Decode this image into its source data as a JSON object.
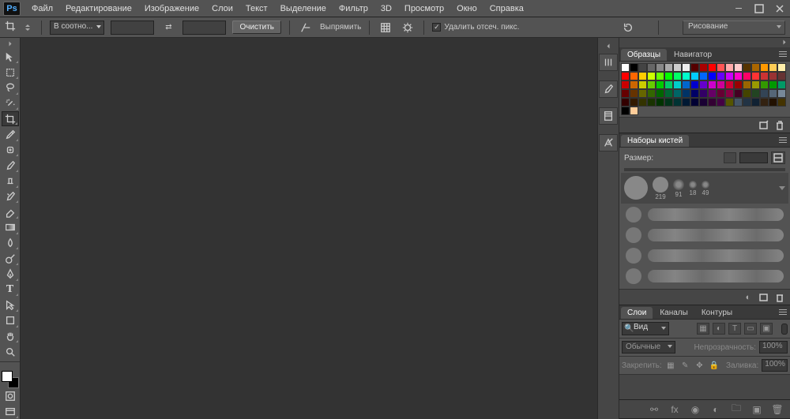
{
  "app": {
    "logo": "Ps"
  },
  "menubar": [
    "Файл",
    "Редактирование",
    "Изображение",
    "Слои",
    "Текст",
    "Выделение",
    "Фильтр",
    "3D",
    "Просмотр",
    "Окно",
    "Справка"
  ],
  "options": {
    "ratio_label": "В соотно...",
    "clear_label": "Очистить",
    "straighten_label": "Выпрямить",
    "delete_cropped_label": "Удалить отсеч. пикс."
  },
  "workspace": {
    "selected": "Рисование"
  },
  "panels": {
    "swatches": {
      "tabs": [
        "Образцы",
        "Навигатор"
      ],
      "active": 0,
      "colors": [
        "#ffffff",
        "#000000",
        "#444444",
        "#666666",
        "#888888",
        "#aaaaaa",
        "#cccccc",
        "#eeeeee",
        "#550000",
        "#aa0000",
        "#ff0000",
        "#ff5555",
        "#ffaaaa",
        "#ffcccc",
        "#553300",
        "#aa6600",
        "#ff9900",
        "#ffcc55",
        "#ffeeaa",
        "#ff0000",
        "#ff6600",
        "#ffcc00",
        "#ccff00",
        "#66ff00",
        "#00ff00",
        "#00ff66",
        "#00ffcc",
        "#00ccff",
        "#0066ff",
        "#0000ff",
        "#6600ff",
        "#cc00ff",
        "#ff00cc",
        "#ff0066",
        "#ff3333",
        "#cc3333",
        "#993333",
        "#663333",
        "#cc0000",
        "#cc6600",
        "#cccc00",
        "#66cc00",
        "#00cc00",
        "#00cc66",
        "#00cccc",
        "#0066cc",
        "#0000cc",
        "#6600cc",
        "#cc00cc",
        "#cc0099",
        "#cc0033",
        "#990000",
        "#996600",
        "#999900",
        "#339900",
        "#009900",
        "#009966",
        "#660000",
        "#663300",
        "#666600",
        "#336600",
        "#006600",
        "#006633",
        "#006666",
        "#003366",
        "#000066",
        "#330066",
        "#660066",
        "#660033",
        "#880044",
        "#440022",
        "#444400",
        "#224422",
        "#334455",
        "#556677",
        "#778899",
        "#330000",
        "#331900",
        "#333300",
        "#193300",
        "#003300",
        "#003319",
        "#003333",
        "#001933",
        "#000033",
        "#190033",
        "#330033",
        "#440044",
        "#555500",
        "#445566",
        "#223344",
        "#112233",
        "#332211",
        "#221100",
        "#443300",
        "#000000",
        "#ffcc99"
      ]
    },
    "brushes": {
      "tabs": [
        "Наборы кистей"
      ],
      "active": 0,
      "size_label": "Размер:",
      "thumbs": [
        {
          "d": 30,
          "v": ""
        },
        {
          "d": 20,
          "v": "219"
        },
        {
          "d": 14,
          "v": "91"
        },
        {
          "d": 10,
          "v": "18"
        },
        {
          "d": 10,
          "v": "49"
        }
      ]
    },
    "layers": {
      "tabs": [
        "Слои",
        "Каналы",
        "Контуры"
      ],
      "active": 0,
      "kind_label": "Вид",
      "blend_mode": "Обычные",
      "opacity_label": "Непрозрачность:",
      "opacity_value": "100%",
      "fill_label": "Заливка:",
      "fill_value": "100%",
      "lock_label": "Закрепить:"
    }
  }
}
